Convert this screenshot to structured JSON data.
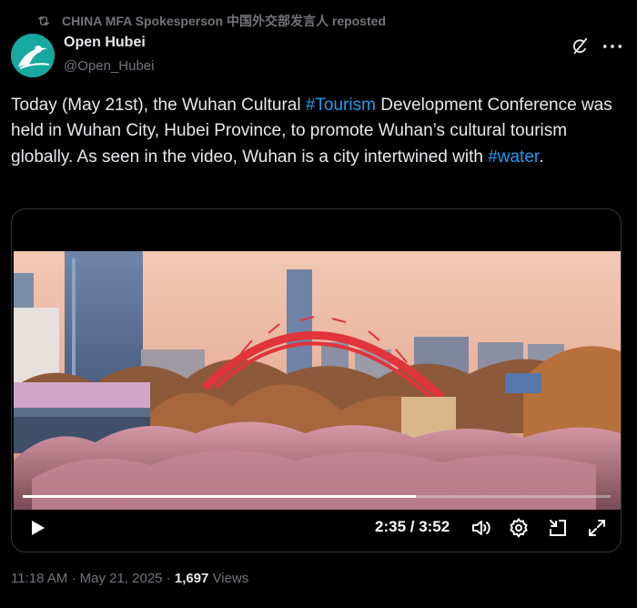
{
  "repost": {
    "text": "CHINA MFA Spokesperson 中国外交部发言人 reposted",
    "icon": "repost-icon"
  },
  "author": {
    "name": "Open Hubei",
    "handle": "@Open_Hubei",
    "avatar_color": "#17a8a0"
  },
  "header_actions": {
    "grok": "grok-icon",
    "more": "more-icon"
  },
  "tweet": {
    "segments": [
      "Today (May 21st), the Wuhan Cultural ",
      "#Tourism",
      " Development Conference was held in Wuhan City, Hubei Province, to promote Wuhan’s cultural tourism globally. As seen in the video, Wuhan is a city intertwined with ",
      "#water",
      "."
    ]
  },
  "video": {
    "current_time": "2:35",
    "duration": "3:52",
    "time_display": "2:35 / 3:52",
    "progress": 0.668,
    "controls": [
      "play-icon",
      "volume-icon",
      "settings-icon",
      "exit-fullscreen-icon",
      "expand-icon"
    ]
  },
  "meta": {
    "time": "11:18 AM",
    "separator": "·",
    "date": "May 21, 2025",
    "views_count": "1,697",
    "views_label": "Views"
  },
  "colors": {
    "background": "#000000",
    "text": "#e7e9ea",
    "muted": "#71767b",
    "link": "#1d9bf0",
    "border": "#2f3336"
  }
}
